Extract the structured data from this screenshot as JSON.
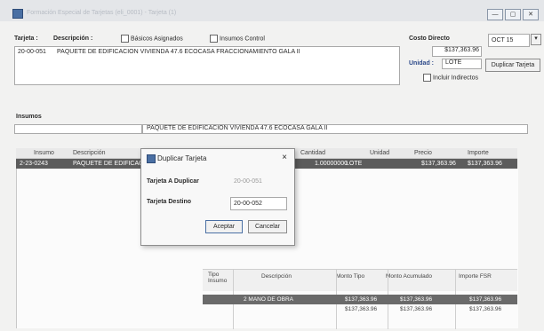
{
  "window": {
    "title": "Formación Especial de Tarjetas (eli_0001) - Tarjeta (1)",
    "controls": [
      "—",
      "▢",
      "✕"
    ]
  },
  "header": {
    "tarjeta_label": "Tarjeta :",
    "descripcion_label": "Descripción :",
    "basicos_label": "Básicos Asignados",
    "insumos_control_label": "Insumos Control",
    "tarjeta_value": "20-00-051",
    "descripcion_value": "PAQUETE DE EDIFICACION VIVIENDA 47.6 ECOCASA FRACCIONAMIENTO GALA II",
    "costo_label": "Costo Directo",
    "costo_value": "$137,363.96",
    "unidad_label": "Unidad :",
    "unidad_value": "LOTE",
    "incluir_label": "Incluir Indirectos",
    "fecha_value": "OCT 15",
    "duplicar_button": "Duplicar Tarjeta"
  },
  "insumos": {
    "section_label": "Insumos",
    "desc_field": "PAQUETE DE EDIFICACION VIVIENDA 47.6 ECOCASA GALA II",
    "columns": [
      "Insumo",
      "Descripción",
      "Cantidad",
      "Unidad",
      "Precio",
      "Importe"
    ],
    "row": {
      "insumo": "2-23-0243",
      "descripcion": "PAQUETE DE EDIFICACION VIVIENDA 47.6 ECOCASA GL...",
      "cantidad": "1.00000000",
      "unidad": "LOTE",
      "precio": "$137,363.96",
      "importe": "$137,363.96"
    }
  },
  "dialog": {
    "title": "Duplicar Tarjeta",
    "close": "×",
    "a_duplicar_label": "Tarjeta A Duplicar",
    "a_duplicar_value": "20-00-051",
    "destino_label": "Tarjeta Destino",
    "destino_value": "20-00-052",
    "aceptar": "Aceptar",
    "cancelar": "Cancelar"
  },
  "resumen": {
    "columns": [
      "Tipo Insumo",
      "Descripción",
      "Monto Tipo",
      "Monto Acumulado",
      "Importe FSR"
    ],
    "row1": {
      "descripcion": "2 MANO DE OBRA",
      "monto_tipo": "$137,363.96",
      "monto_acumulado": "$137,363.96",
      "importe_fsr": "$137,363.96"
    },
    "row2": {
      "monto_tipo": "$137,363.96",
      "monto_acumulado": "$137,363.96",
      "importe_fsr": "$137,363.96"
    }
  }
}
